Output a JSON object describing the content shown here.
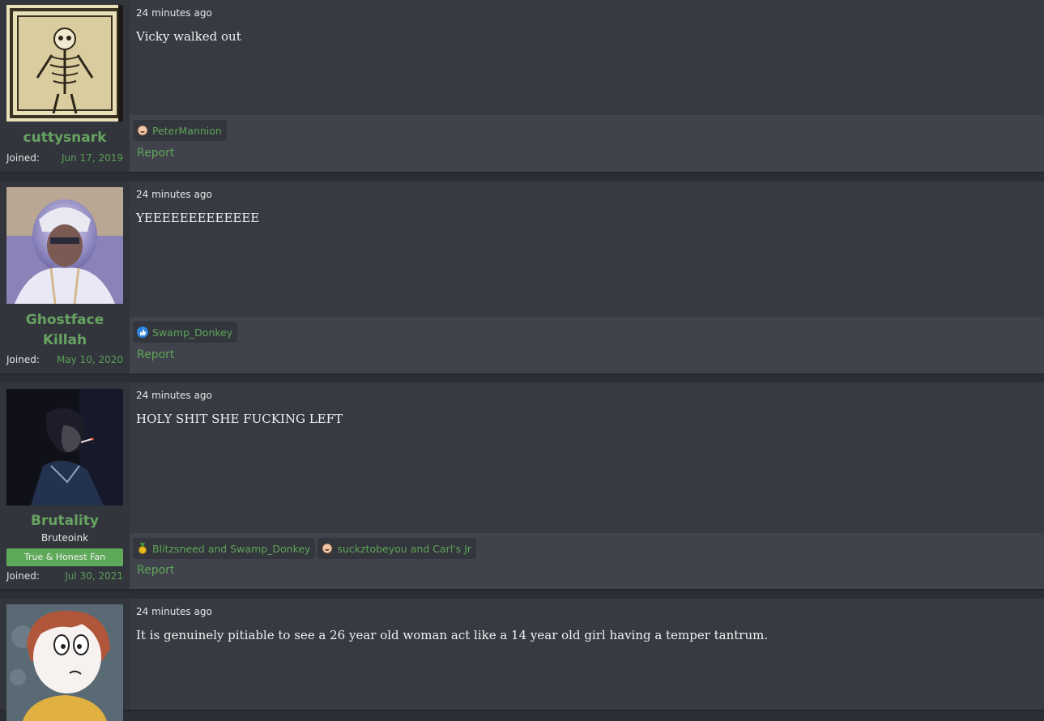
{
  "posts": [
    {
      "time": "24 minutes ago",
      "message": "Vicky walked out",
      "username": "cuttysnark",
      "joined_label": "Joined:",
      "joined_date": "Jun 17, 2019",
      "reactions": [
        {
          "icon": "laughing-face-icon",
          "text": "PeterMannion"
        }
      ],
      "report_label": "Report"
    },
    {
      "time": "24 minutes ago",
      "message": "YEEEEEEEEEEEEE",
      "username_line1": "Ghostface",
      "username_line2": "Killah",
      "joined_label": "Joined:",
      "joined_date": "May 10, 2020",
      "reactions": [
        {
          "icon": "thumbs-up-icon",
          "text": "Swamp_Donkey"
        }
      ],
      "report_label": "Report"
    },
    {
      "time": "24 minutes ago",
      "message": "HOLY SHIT SHE FUCKING LEFT",
      "username": "Brutality",
      "user_title": "Bruteoink",
      "banner": "True & Honest Fan",
      "joined_label": "Joined:",
      "joined_date": "Jul 30, 2021",
      "reactions": [
        {
          "icon": "medal-icon",
          "text": "Blitzsneed and Swamp_Donkey"
        },
        {
          "icon": "laughing-face-icon",
          "text": "suckztobeyou and Carl's Jr"
        }
      ],
      "report_label": "Report"
    },
    {
      "time": "24 minutes ago",
      "message": "It is genuinely pitiable to see a 26 year old woman act like a 14 year old girl having a temper tantrum."
    }
  ],
  "colors": {
    "page_bg": "#2b2e34",
    "post_bg": "#373a42",
    "footer_bg": "#40434b",
    "accent_green": "#67a361",
    "banner_green": "#5faa5a"
  }
}
